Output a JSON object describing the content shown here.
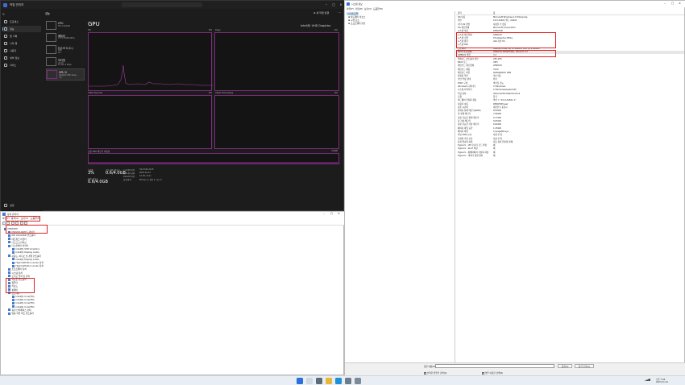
{
  "task_manager": {
    "title": "작업 관리자",
    "nav": [
      "프로세스",
      "성능",
      "앱 기록",
      "시작 앱",
      "사용자",
      "세부 정보",
      "서비스"
    ],
    "nav_settings": "설정",
    "perf_heading": "성능",
    "run_task": "새 작업 실행",
    "resources": [
      {
        "name": "CPU",
        "l2": "9% 2.61GHz",
        "l3": ""
      },
      {
        "name": "메모리",
        "l2": "7.7/7.8 GB (99%)",
        "l3": ""
      },
      {
        "name": "디스크 0 (C:)",
        "l2": "SSD",
        "l3": "0%"
      },
      {
        "name": "이더넷",
        "l2": "이더넷",
        "l3": "S: 0 R: 0 Kbps"
      },
      {
        "name": "GPU 0",
        "l2": "Intel(R) UHD Grap...",
        "l3": "3%"
      }
    ],
    "gpu_heading": "GPU",
    "gpu_model": "Intel(R) UHD Graphics",
    "graph_labels": {
      "g1": "3D",
      "g2": "Copy",
      "g3": "Video Decode",
      "g4": "Video Processing"
    },
    "graph_pct": "0%",
    "shared_label": "공유 GPU 메모리 사용량",
    "shared_max": "3.9GB",
    "stats": {
      "util_label": "사용률",
      "util_value": "3%",
      "shared_label": "공유 GPU 메모리",
      "shared_value": "0.6/4.0GB",
      "gpu_mem_label": "GPU 메모리",
      "gpu_mem_value": "0.6/4.0GB",
      "driver_ver_label": "드라이버 버전:",
      "driver_ver": "31.0.101.2115",
      "driver_date_label": "드라이버 날짜:",
      "driver_date": "2022-10-12",
      "directx_label": "DirectX 버전:",
      "directx": "12 (FL 12.1)",
      "location_label": "실제 위치:",
      "location": "PCI 버스 0, 장치 2, 기능 0"
    }
  },
  "device_manager": {
    "title": "장치 관리자",
    "menu": [
      "파일(F)",
      "동작(A)",
      "보기(V)",
      "도움말(H)"
    ],
    "tree": [
      {
        "label": "DESKTOP",
        "indent": 0
      },
      {
        "label": "DVD/CD-ROM 드라이브",
        "indent": 1
      },
      {
        "label": "IDE ATA/ATAPI 컨트롤러",
        "indent": 1
      },
      {
        "label": "네트워크 어댑터",
        "indent": 1
      },
      {
        "label": "디스크 드라이브",
        "indent": 1
      },
      {
        "label": "디스플레이 어댑터",
        "indent": 1
      },
      {
        "label": "Intel(R) UHD Graphics",
        "indent": 2
      },
      {
        "label": "Intel(R) Display Audio",
        "indent": 2
      },
      {
        "label": "사운드, 비디오 및 게임 컨트롤러",
        "indent": 1
      },
      {
        "label": "Intel(R) Display Audio",
        "indent": 2
      },
      {
        "label": "High Definition Audio 장치",
        "indent": 2
      },
      {
        "label": "High Definition Audio 장치",
        "indent": 2
      },
      {
        "label": "소프트웨어 장치",
        "indent": 1
      },
      {
        "label": "시스템 장치",
        "indent": 1
      },
      {
        "label": "오디오 입력 및 출력",
        "indent": 1
      },
      {
        "label": "저장소 컨트롤러",
        "indent": 1
      },
      {
        "label": "컴퓨터",
        "indent": 1
      },
      {
        "label": "키보드",
        "indent": 1
      },
      {
        "label": "펌웨어",
        "indent": 1
      },
      {
        "label": "프로세서",
        "indent": 1
      },
      {
        "label": "Intel(R) Core(TM)",
        "indent": 2
      },
      {
        "label": "Intel(R) Core(TM)",
        "indent": 2
      },
      {
        "label": "Intel(R) Core(TM)",
        "indent": 2
      },
      {
        "label": "Intel(R) Core(TM)",
        "indent": 2
      },
      {
        "label": "휴먼 인터페이스 장치",
        "indent": 1
      },
      {
        "label": "범용 직렬 버스 컨트롤러",
        "indent": 1
      }
    ]
  },
  "system_info": {
    "title": "시스템 정보",
    "menu": [
      "파일(F)",
      "편집(E)",
      "보기(V)",
      "도움말(H)"
    ],
    "tree": [
      "시스템 요약",
      "하드웨어 리소스",
      "구성 요소",
      "소프트웨어 환경"
    ],
    "col_item": "항목",
    "col_value": "값",
    "rows": [
      {
        "k": "OS 이름",
        "v": "Microsoft Windows 11 Enterprise"
      },
      {
        "k": "버전",
        "v": "10.0.22621 빌드 22621"
      },
      {
        "k": "기타 OS 설명",
        "v": "사용할 수 없음"
      },
      {
        "k": "OS 제조업체",
        "v": "Microsoft Corporation"
      },
      {
        "k": "시스템 이름",
        "v": "DESKTOP"
      },
      {
        "k": "시스템 제조업체",
        "v": "LENOVO"
      },
      {
        "k": "시스템 모델",
        "v": "ThinkCentre M70q"
      },
      {
        "k": "시스템 종류",
        "v": "x64 기반 PC"
      },
      {
        "k": "시스템 SKU",
        "v": ""
      },
      {
        "k": "프로세서",
        "v": "Intel(R) Core(TM) i5-10400T CPU @ 2.00GHz"
      },
      {
        "k": "BIOS 버전/날짜",
        "v": "LENOVO M2WKT46A, 2022-07-21"
      },
      {
        "k": "SMBIOS 버전",
        "v": "3.2"
      },
      {
        "k": "임베디드 컨트롤러 버전",
        "v": "255.255"
      },
      {
        "k": "BIOS 모드",
        "v": "UEFI"
      },
      {
        "k": "메인보드 제조업체",
        "v": "LENOVO"
      },
      {
        "k": "메인보드 제품",
        "v": "313C"
      },
      {
        "k": "메인보드 버전",
        "v": "SDK0J40697 WIN"
      },
      {
        "k": "플랫폼 역할",
        "v": "데스크톱"
      },
      {
        "k": "보안 부팅 상태",
        "v": "켜기"
      },
      {
        "k": "PCR7 구성",
        "v": "바인딩 가능"
      },
      {
        "k": "Windows 디렉터리",
        "v": "C:\\Windows"
      },
      {
        "k": "시스템 디렉터리",
        "v": "C:\\Windows\\system32"
      },
      {
        "k": "부팅 장치",
        "v": "\\Device\\HarddiskVolume1"
      },
      {
        "k": "로캘",
        "v": "한국"
      },
      {
        "k": "하드웨어 추상화 계층",
        "v": "버전 = \"10.0.22621.1\""
      },
      {
        "k": "사용자 이름",
        "v": "DESKTOP\\user"
      },
      {
        "k": "표준 시간대",
        "v": "대한민국 표준시"
      },
      {
        "k": "설치된 실제 메모리(RAM)",
        "v": "8.00GB"
      },
      {
        "k": "총 실제 메모리",
        "v": "7.80GB"
      },
      {
        "k": "사용 가능한 실제 메모리",
        "v": "0.17GB"
      },
      {
        "k": "총 가상 메모리",
        "v": "9.05GB"
      },
      {
        "k": "사용 가능한 가상 메모리",
        "v": "0.62GB"
      },
      {
        "k": "페이지 파일 공간",
        "v": "1.25GB"
      },
      {
        "k": "페이지 파일",
        "v": "C:\\pagefile.sys"
      },
      {
        "k": "커널 DMA 보호",
        "v": "사용 안 함"
      },
      {
        "k": "가상화 기반 보안",
        "v": "사용 안 함"
      },
      {
        "k": "장치 암호화 지원",
        "v": "자동 장치 암호화 실패"
      },
      {
        "k": "Hyper-V - VM 모니터 모드 확장",
        "v": "예"
      },
      {
        "k": "Hyper-V - SLAT 확장",
        "v": "예"
      },
      {
        "k": "Hyper-V - 펌웨어에서 가상화 사용",
        "v": "예"
      },
      {
        "k": "Hyper-V - 데이터 실행 방지",
        "v": "예"
      }
    ],
    "find_label": "찾을 내용(W):",
    "find_btn": "찾기(D)",
    "close_find_btn": "찾기 닫기(C)",
    "chk_selected": "선택한 범주만 검색(S)",
    "chk_names": "범주 이름만 검색(R)"
  },
  "taskbar": {
    "time": "오후 7:04",
    "date": "2023-11-21"
  }
}
